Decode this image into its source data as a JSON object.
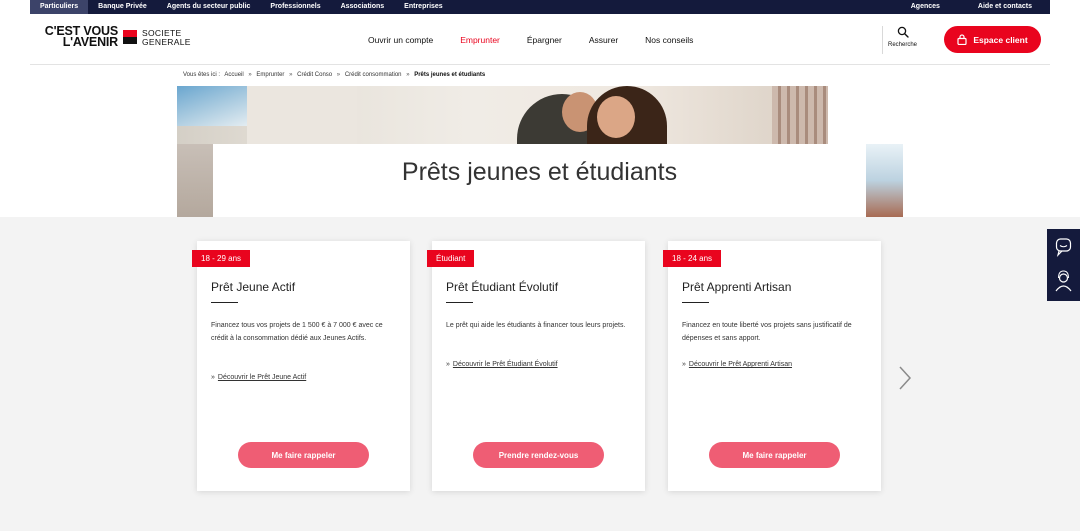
{
  "topbar": {
    "left": [
      "Particuliers",
      "Banque Privée",
      "Agents du secteur public",
      "Professionnels",
      "Associations",
      "Entreprises"
    ],
    "right": [
      "Agences",
      "Aide et contacts"
    ]
  },
  "logo": {
    "slogan_line1": "C'EST VOUS",
    "slogan_line2": "L'AVENIR",
    "brand_line1": "SOCIETE",
    "brand_line2": "GENERALE"
  },
  "nav": [
    "Ouvrir un compte",
    "Emprunter",
    "Épargner",
    "Assurer",
    "Nos conseils"
  ],
  "search": {
    "label": "Recherche",
    "icon": "search-icon"
  },
  "espace_client": {
    "label": "Espace client",
    "icon": "lock-icon",
    "color": "#e9041e"
  },
  "breadcrumb": {
    "prefix": "Vous êtes ici :",
    "items": [
      "Accueil",
      "Emprunter",
      "Crédit Conso",
      "Crédit consommation",
      "Prêts jeunes et étudiants"
    ],
    "separator": "»"
  },
  "page_title": "Prêts jeunes et étudiants",
  "cards": [
    {
      "tag": "18 - 29 ans",
      "title": "Prêt Jeune Actif",
      "description": "Financez tous vos projets de 1 500 € à 7 000 € avec ce crédit à la consommation dédié aux Jeunes Actifs.",
      "link_arrow": "»",
      "link": "Découvrir le Prêt Jeune Actif",
      "cta": "Me faire rappeler"
    },
    {
      "tag": "Étudiant",
      "title": "Prêt Étudiant Évolutif",
      "description": "Le prêt qui aide les étudiants à financer tous leurs projets.",
      "link_arrow": "»",
      "link": "Découvrir le Prêt Étudiant Évolutif",
      "cta": "Prendre rendez-vous"
    },
    {
      "tag": "18 - 24 ans",
      "title": "Prêt Apprenti Artisan",
      "description": "Financez en toute liberté vos projets sans justificatif de dépenses et sans apport.",
      "link_arrow": "»",
      "link": "Découvrir le Prêt Apprenti Artisan",
      "cta": "Me faire rappeler"
    }
  ],
  "carousel": {
    "next_icon": "chevron-right-icon"
  },
  "side_widget": {
    "icons": [
      "chat-icon",
      "advisor-icon"
    ]
  },
  "colors": {
    "brand_red": "#e9041e",
    "cta_pink": "#ef5d74",
    "navy": "#141a3c",
    "band_gray": "#f3f3f3"
  }
}
